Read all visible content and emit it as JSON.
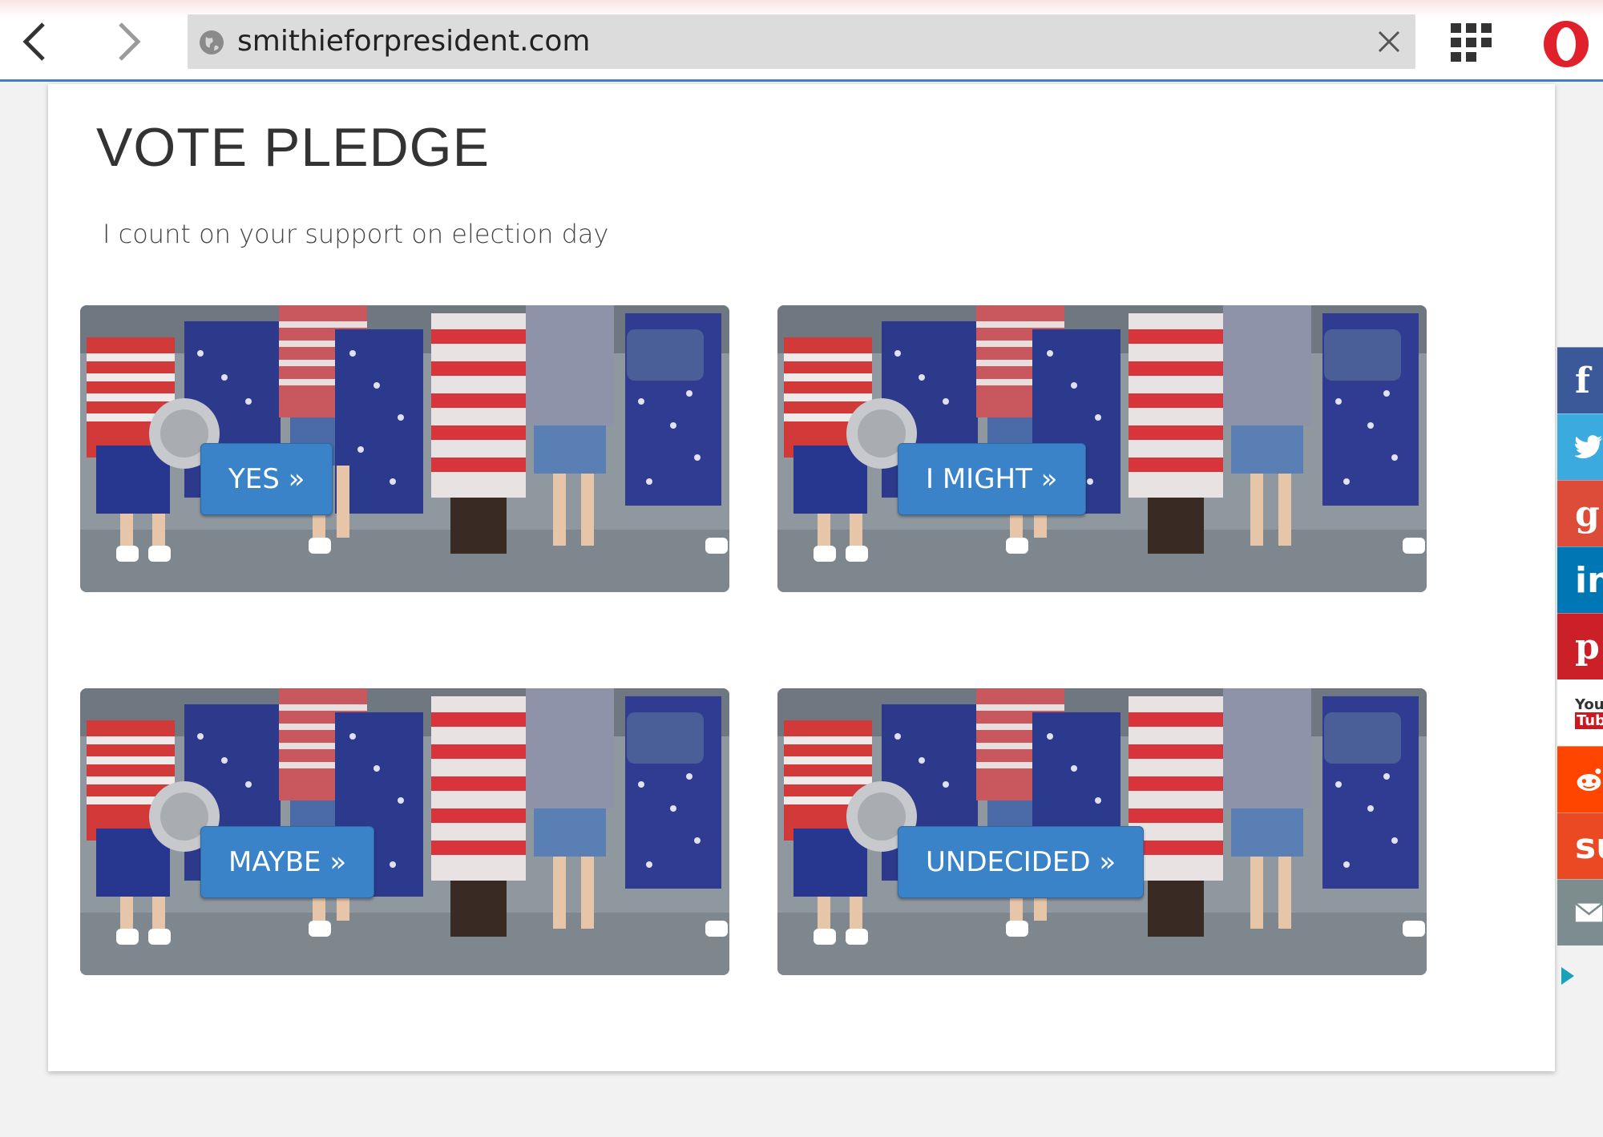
{
  "browser": {
    "url": "smithieforpresident.com",
    "icons": {
      "back": "chevron-left-icon",
      "forward": "chevron-right-icon",
      "site": "globe-icon",
      "clear": "close-icon",
      "speed_dial": "grid-icon",
      "menu": "opera-logo-icon"
    },
    "accent_color": "#3f7fc4"
  },
  "page": {
    "title": "VOTE PLEDGE",
    "subtitle": "I count on your support on election day",
    "options": [
      {
        "label": "YES »"
      },
      {
        "label": "I MIGHT »"
      },
      {
        "label": "MAYBE »"
      },
      {
        "label": "UNDECIDED »"
      }
    ],
    "button_color": "#3a83c9"
  },
  "share_bar": {
    "items": [
      {
        "network": "facebook",
        "glyph": "f",
        "color": "#3b5998"
      },
      {
        "network": "twitter",
        "glyph": "t",
        "color": "#3aaadf"
      },
      {
        "network": "google-plus",
        "glyph": "g+",
        "color": "#dd4b39"
      },
      {
        "network": "linkedin",
        "glyph": "in",
        "color": "#0077b5"
      },
      {
        "network": "pinterest",
        "glyph": "p",
        "color": "#cb2027"
      },
      {
        "network": "youtube",
        "glyph": "You Tube",
        "color": "#ffffff"
      },
      {
        "network": "reddit",
        "glyph": "☺",
        "color": "#ff4500"
      },
      {
        "network": "stumbleupon",
        "glyph": "su",
        "color": "#eb4924"
      },
      {
        "network": "email",
        "glyph": "✉",
        "color": "#7d8c8f"
      }
    ]
  }
}
